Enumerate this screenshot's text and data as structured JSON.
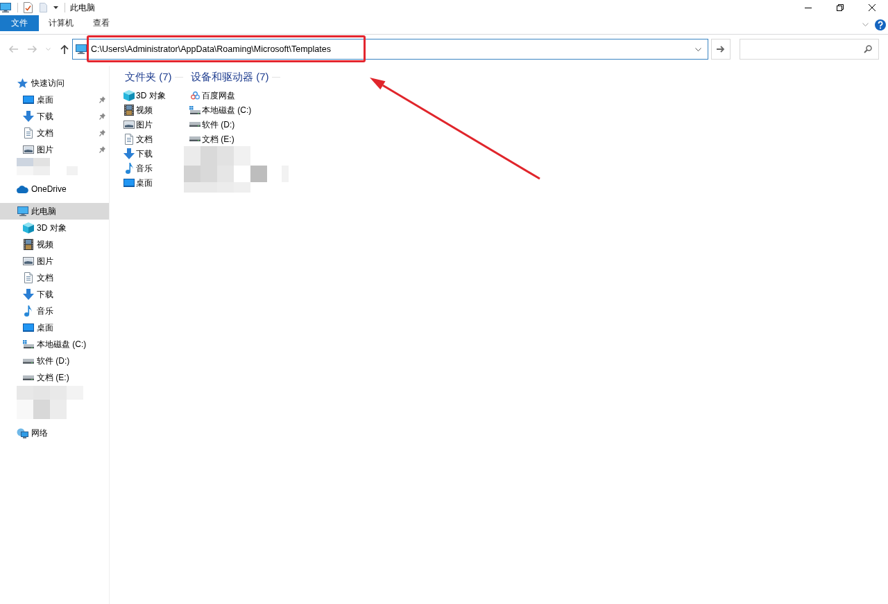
{
  "window": {
    "title": "此电脑"
  },
  "ribbon": {
    "tabs": [
      {
        "label": "文件",
        "kind": "file",
        "selected": false
      },
      {
        "label": "计算机",
        "kind": "tab",
        "selected": false
      },
      {
        "label": "查看",
        "kind": "tab",
        "selected": false
      }
    ]
  },
  "navigation": {
    "buttons": [
      {
        "kind": "back",
        "disabled": true
      },
      {
        "kind": "forward",
        "disabled": true
      },
      {
        "kind": "recent",
        "disabled": true
      },
      {
        "kind": "up",
        "disabled": false
      }
    ],
    "address": "C:\\Users\\Administrator\\AppData\\Roaming\\Microsoft\\Templates"
  },
  "sidebar": {
    "items": [
      {
        "label": "快速访问",
        "kind": "quickaccess",
        "selected": false,
        "children": [
          {
            "label": "桌面",
            "kind": "desktop",
            "selected": false,
            "pinned": true
          },
          {
            "label": "下载",
            "kind": "download",
            "selected": false,
            "pinned": true
          },
          {
            "label": "文档",
            "kind": "document",
            "selected": false,
            "pinned": true
          },
          {
            "label": "图片",
            "kind": "picture",
            "selected": false,
            "pinned": true
          }
        ]
      },
      {
        "kind": "redacted",
        "selected": false
      },
      {
        "label": "OneDrive",
        "kind": "onedrive",
        "selected": false
      },
      {
        "label": "此电脑",
        "kind": "computer",
        "selected": true,
        "children": [
          {
            "label": "3D 对象",
            "kind": "objects",
            "selected": false
          },
          {
            "label": "视频",
            "kind": "video",
            "selected": false
          },
          {
            "label": "图片",
            "kind": "picture",
            "selected": false
          },
          {
            "label": "文档",
            "kind": "document",
            "selected": false
          },
          {
            "label": "下载",
            "kind": "download",
            "selected": false
          },
          {
            "label": "音乐",
            "kind": "music",
            "selected": false
          },
          {
            "label": "桌面",
            "kind": "desktop",
            "selected": false
          },
          {
            "label": "本地磁盘 (C:)",
            "kind": "systemdrive",
            "selected": false
          },
          {
            "label": "软件 (D:)",
            "kind": "drive",
            "selected": false
          },
          {
            "label": "文档 (E:)",
            "kind": "drive",
            "selected": false
          }
        ]
      },
      {
        "kind": "redacted",
        "selected": false
      },
      {
        "label": "网络",
        "kind": "network",
        "selected": false
      }
    ]
  },
  "content": {
    "groups": [
      {
        "title": "文件夹 (7)",
        "items": [
          {
            "label": "3D 对象",
            "kind": "objects",
            "selected": false
          },
          {
            "label": "视频",
            "kind": "video",
            "selected": false
          },
          {
            "label": "图片",
            "kind": "picture",
            "selected": false
          },
          {
            "label": "文档",
            "kind": "document",
            "selected": false
          },
          {
            "label": "下载",
            "kind": "download",
            "selected": false
          },
          {
            "label": "音乐",
            "kind": "music",
            "selected": false
          },
          {
            "label": "桌面",
            "kind": "desktop",
            "selected": false
          }
        ]
      },
      {
        "title": "设备和驱动器 (7)",
        "items": [
          {
            "label": "百度网盘",
            "kind": "clouddrive",
            "selected": false
          },
          {
            "label": "本地磁盘 (C:)",
            "kind": "systemdrive",
            "selected": false
          },
          {
            "label": "软件 (D:)",
            "kind": "drive",
            "selected": false
          },
          {
            "label": "文档 (E:)",
            "kind": "drive",
            "selected": false
          },
          {
            "kind": "redacted",
            "selected": false
          }
        ]
      }
    ]
  }
}
